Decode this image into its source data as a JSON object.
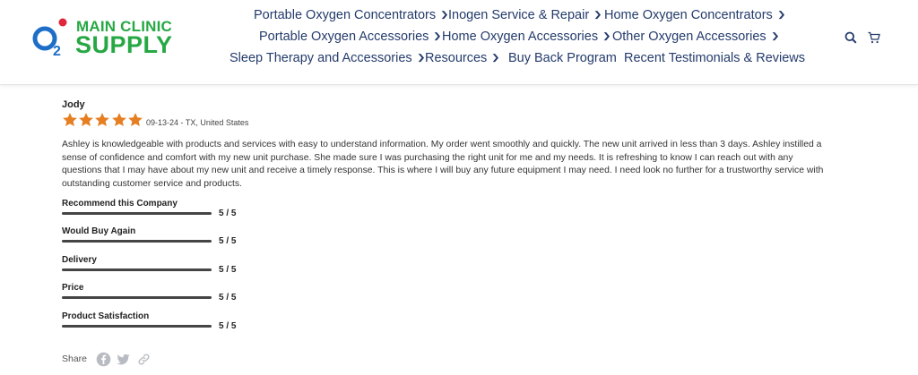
{
  "brand": {
    "line1": "MAIN CLINIC",
    "line2": "SUPPLY",
    "mark_letter": "O",
    "mark_subscript": "2",
    "green": "#27a844",
    "blue": "#1e6ec8",
    "red": "#e0263b"
  },
  "nav": {
    "row1": [
      {
        "label": "Portable Oxygen Concentrators",
        "dropdown": true
      },
      {
        "label": "Inogen Service & Repair",
        "dropdown": true
      },
      {
        "label": "Home Oxygen Concentrators",
        "dropdown": true
      }
    ],
    "row2": [
      {
        "label": "Portable Oxygen Accessories",
        "dropdown": true
      },
      {
        "label": "Home Oxygen Accessories",
        "dropdown": true
      },
      {
        "label": "Other Oxygen Accessories",
        "dropdown": true
      }
    ],
    "row3": [
      {
        "label": "Sleep Therapy and Accessories",
        "dropdown": true
      },
      {
        "label": "Resources",
        "dropdown": true
      },
      {
        "label": "Buy Back Program",
        "dropdown": false
      },
      {
        "label": "Recent Testimonials & Reviews",
        "dropdown": false
      }
    ],
    "chevron": "⌄",
    "text_color": "#243b6b"
  },
  "header_icons": [
    "search-icon",
    "cart-icon"
  ],
  "review": {
    "author": "Jody",
    "stars": 5,
    "star_color": "#e67e22",
    "meta": "09-13-24 - TX, United States",
    "body_lines": [
      "Ashley is knowledgeable with products and services with easy to understand information. My order went smoothly and quickly. The new unit arrived in less than 3 days. Ashley instilled a",
      "sense of confidence and comfort with my new unit purchase. She made sure I was purchasing the right unit for me and my needs. It is refreshing to know I can reach out with any",
      "questions that I may have about my new unit and receive a timely response. This is where I will buy any future equipment I may need. I need look no further for a trustworthy service with",
      "outstanding customer service and products."
    ],
    "ratings": [
      {
        "label": "Recommend this Company",
        "value": "5 / 5",
        "fraction": 1.0
      },
      {
        "label": "Would Buy Again",
        "value": "5 / 5",
        "fraction": 1.0
      },
      {
        "label": "Delivery",
        "value": "5 / 5",
        "fraction": 1.0
      },
      {
        "label": "Price",
        "value": "5 / 5",
        "fraction": 1.0
      },
      {
        "label": "Product Satisfaction",
        "value": "5 / 5",
        "fraction": 1.0
      }
    ],
    "share_label": "Share",
    "share_icons": [
      "facebook-icon",
      "twitter-icon",
      "link-icon"
    ]
  }
}
